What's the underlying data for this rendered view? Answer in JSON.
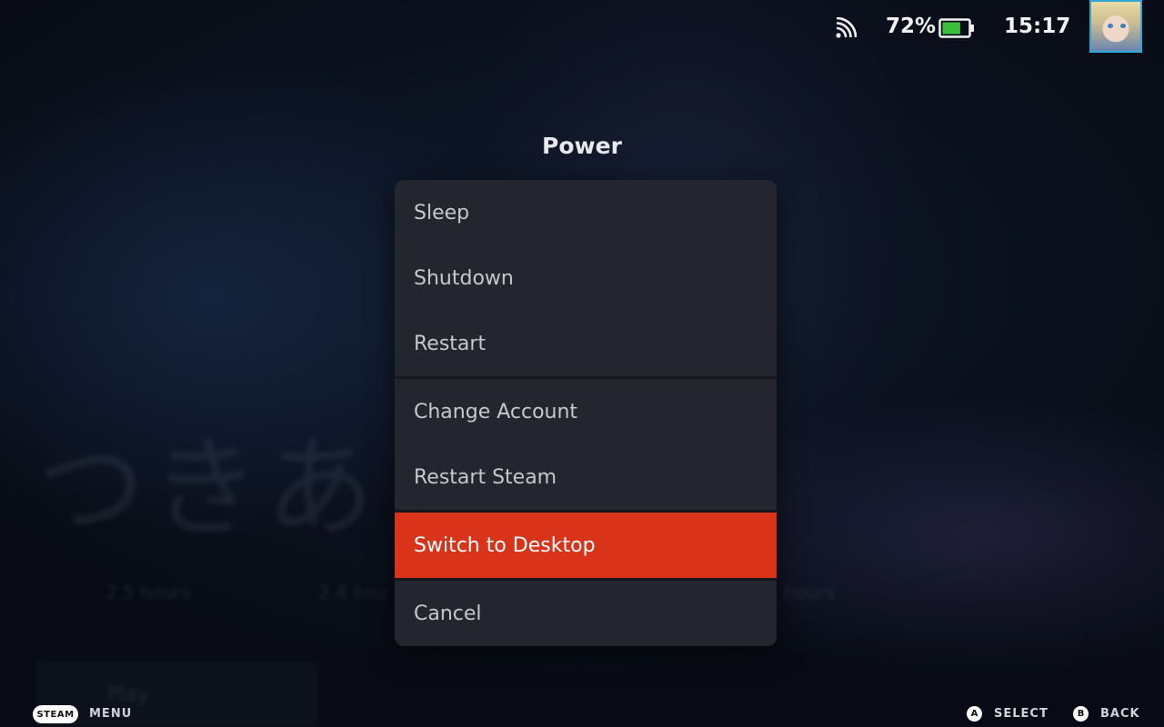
{
  "background": {
    "kana_text": "つきあ",
    "stat_texts": [
      "2.5 hours",
      "2.4 hou",
      "hours"
    ],
    "play_label": "Play"
  },
  "status_bar": {
    "battery_percent": "72%",
    "battery_level": 0.72,
    "battery_color": "#3bbf3b",
    "time": "15:17",
    "wifi_icon": "wifi-icon"
  },
  "dialog": {
    "title": "Power",
    "items": [
      {
        "label": "Sleep"
      },
      {
        "label": "Shutdown"
      },
      {
        "label": "Restart"
      },
      {
        "label": "Change Account"
      },
      {
        "label": "Restart Steam"
      },
      {
        "label": "Switch to Desktop",
        "selected": true
      },
      {
        "label": "Cancel"
      }
    ],
    "accent_color": "#d93419"
  },
  "footer": {
    "steam_button": "STEAM",
    "menu_label": "MENU",
    "a_glyph": "A",
    "select_label": "SELECT",
    "b_glyph": "B",
    "back_label": "BACK"
  }
}
